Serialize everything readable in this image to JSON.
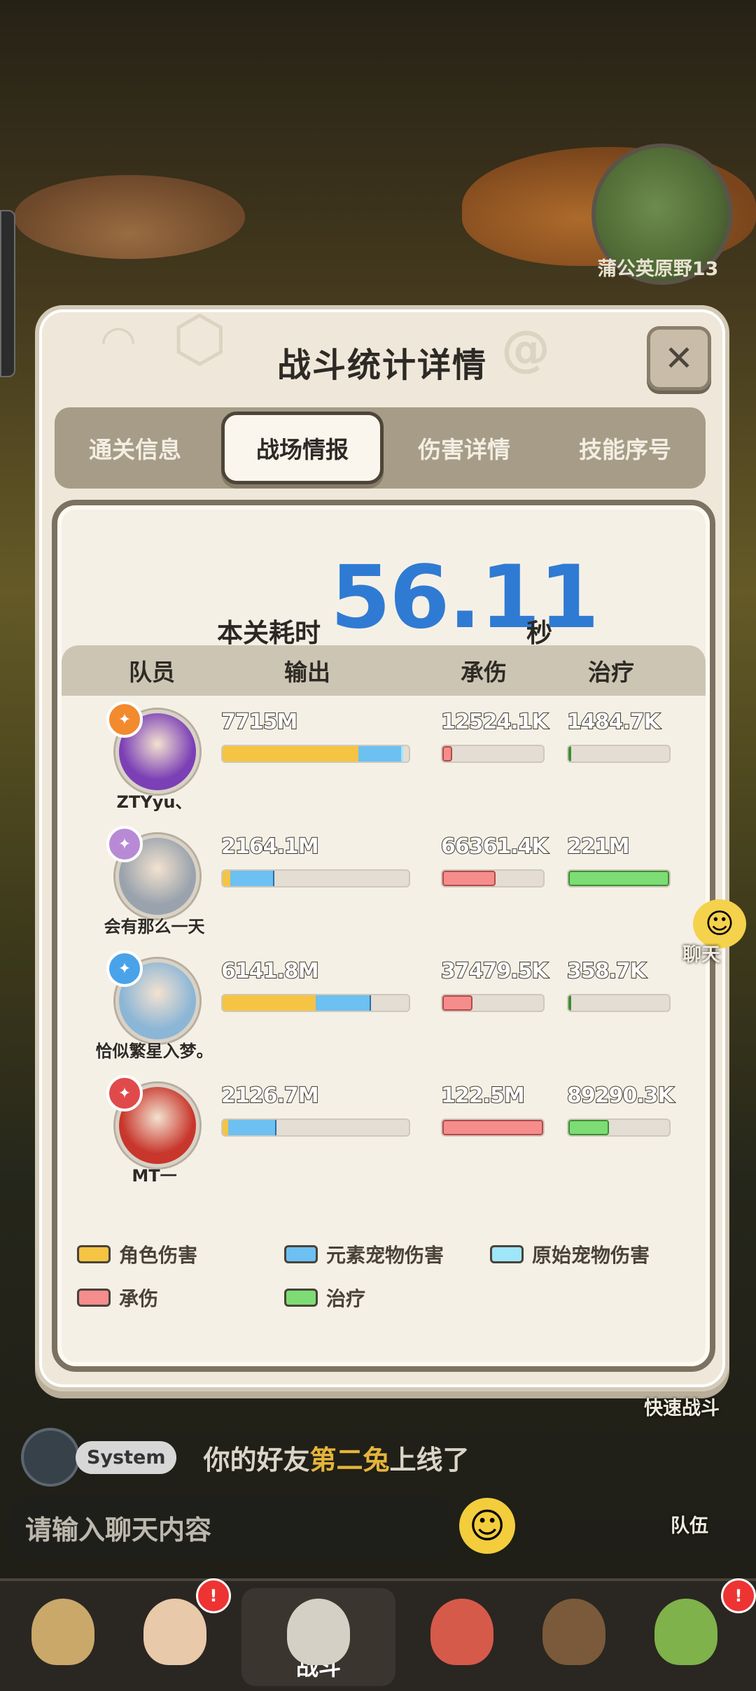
{
  "background": {
    "location_label": "蒲公英原野13"
  },
  "modal": {
    "title": "战斗统计详情",
    "tabs": [
      {
        "label": "通关信息",
        "active": false
      },
      {
        "label": "战场情报",
        "active": true
      },
      {
        "label": "伤害详情",
        "active": false
      },
      {
        "label": "技能序号",
        "active": false
      }
    ],
    "time": {
      "label": "本关耗时",
      "value": "56.11",
      "unit": "秒"
    },
    "table": {
      "headers": [
        "队员",
        "输出",
        "承伤",
        "治疗"
      ],
      "rows": [
        {
          "name": "ZTYyu、",
          "badge_color": "#f28a2e",
          "avatar_color": "#7b3fb6",
          "output": {
            "text": "7715M",
            "role_dmg": 0.73,
            "element_pet_dmg": 0.23,
            "original_pet_dmg": 0.01
          },
          "damage_taken": {
            "text": "12524.1K",
            "fill": 0.1
          },
          "healing": {
            "text": "1484.7K",
            "fill": 0.01
          }
        },
        {
          "name": "会有那么一天",
          "badge_color": "#b88ad6",
          "avatar_color": "#9aa3ad",
          "output": {
            "text": "2164.1M",
            "role_dmg": 0.04,
            "element_pet_dmg": 0.23,
            "original_pet_dmg": 0.0
          },
          "damage_taken": {
            "text": "66361.4K",
            "fill": 0.53
          },
          "healing": {
            "text": "221M",
            "fill": 1.0
          }
        },
        {
          "name": "恰似繁星入梦。",
          "badge_color": "#4aa3e8",
          "avatar_color": "#8cb6d6",
          "output": {
            "text": "6141.8M",
            "role_dmg": 0.5,
            "element_pet_dmg": 0.29,
            "original_pet_dmg": 0.0
          },
          "damage_taken": {
            "text": "37479.5K",
            "fill": 0.3
          },
          "healing": {
            "text": "358.7K",
            "fill": 0.0
          }
        },
        {
          "name": "MT一",
          "badge_color": "#e04a4a",
          "avatar_color": "#c8362c",
          "output": {
            "text": "2126.7M",
            "role_dmg": 0.03,
            "element_pet_dmg": 0.25,
            "original_pet_dmg": 0.0
          },
          "damage_taken": {
            "text": "122.5M",
            "fill": 1.0
          },
          "healing": {
            "text": "89290.3K",
            "fill": 0.4
          }
        }
      ]
    },
    "legend": [
      {
        "label": "角色伤害",
        "color": "#f6c443"
      },
      {
        "label": "元素宠物伤害",
        "color": "#6cc0f2"
      },
      {
        "label": "原始宠物伤害",
        "color": "#9fe6fb"
      },
      {
        "label": "承伤",
        "color": "#f58d8d"
      },
      {
        "label": "治疗",
        "color": "#7ddc74"
      }
    ]
  },
  "chat": {
    "system_badge": "System",
    "message_prefix": "你的好友",
    "message_name": "第二兔",
    "message_suffix": "上线了",
    "input_placeholder": "请输入聊天内容"
  },
  "side": {
    "chat_label": "聊天",
    "quick_battle_label": "快速战斗",
    "team_label": "队伍"
  },
  "nav": {
    "battle_label": "战斗"
  }
}
